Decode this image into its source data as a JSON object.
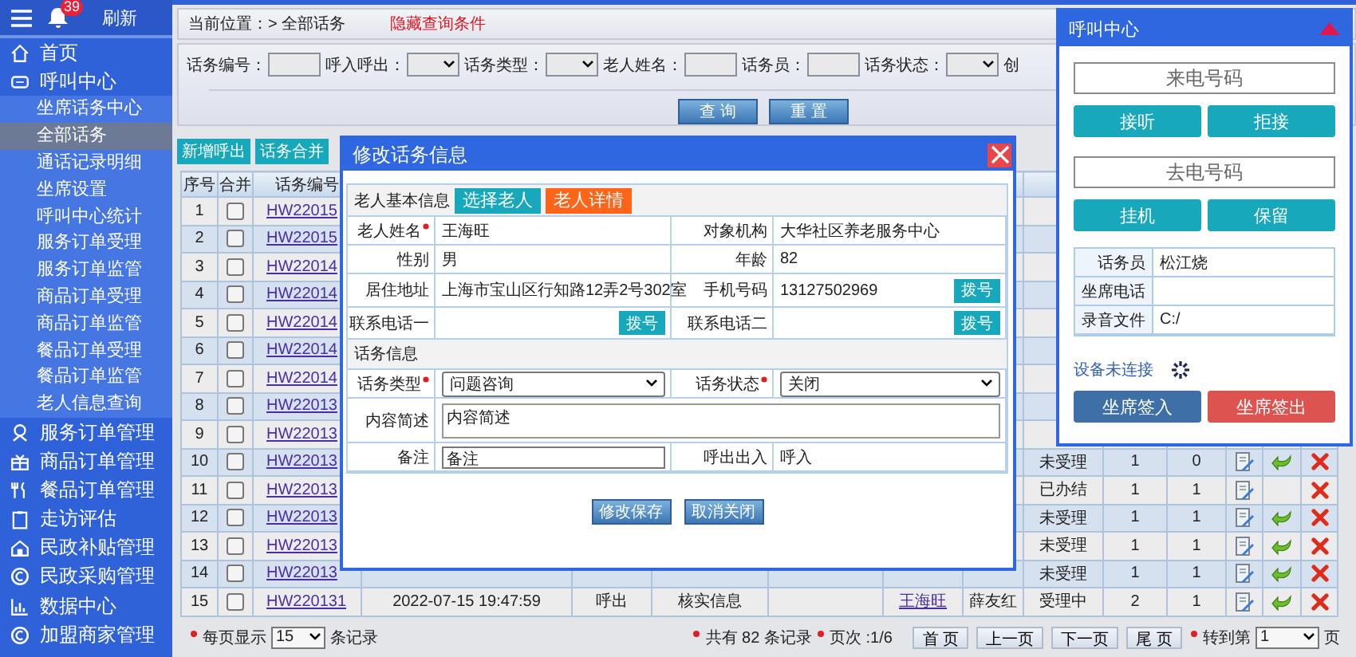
{
  "sidebar": {
    "badge": "39",
    "refresh": "刷新",
    "items": [
      {
        "label": "首页",
        "selected": false
      },
      {
        "label": "呼叫中心",
        "selected": false,
        "expanded": true,
        "children": [
          {
            "label": "坐席话务中心",
            "selected": false
          },
          {
            "label": "全部话务",
            "selected": true
          },
          {
            "label": "通话记录明细",
            "selected": false
          },
          {
            "label": "坐席设置",
            "selected": false
          },
          {
            "label": "呼叫中心统计",
            "selected": false
          },
          {
            "label": "服务订单受理",
            "selected": false
          },
          {
            "label": "服务订单监管",
            "selected": false
          },
          {
            "label": "商品订单受理",
            "selected": false
          },
          {
            "label": "商品订单监管",
            "selected": false
          },
          {
            "label": "餐品订单受理",
            "selected": false
          },
          {
            "label": "餐品订单监管",
            "selected": false
          },
          {
            "label": "老人信息查询",
            "selected": false
          }
        ]
      },
      {
        "label": "服务订单管理",
        "selected": false
      },
      {
        "label": "商品订单管理",
        "selected": false
      },
      {
        "label": "餐品订单管理",
        "selected": false
      },
      {
        "label": "走访评估",
        "selected": false
      },
      {
        "label": "民政补贴管理",
        "selected": false
      },
      {
        "label": "民政采购管理",
        "selected": false
      },
      {
        "label": "数据中心",
        "selected": false
      },
      {
        "label": "加盟商家管理",
        "selected": false
      }
    ]
  },
  "breadcrumb": "当前位置：> 全部话务",
  "hide_link": "隐藏查询条件",
  "search": {
    "fields": [
      {
        "label": "话务编号：",
        "kind": "input"
      },
      {
        "label": "呼入呼出：",
        "kind": "select"
      },
      {
        "label": "话务类型：",
        "kind": "select"
      },
      {
        "label": "老人姓名：",
        "kind": "input"
      },
      {
        "label": "话务员：",
        "kind": "input"
      },
      {
        "label": "话务状态：",
        "kind": "select"
      },
      {
        "label": "创",
        "kind": "label"
      }
    ],
    "buttons": [
      "查 询",
      "重 置"
    ]
  },
  "toolbar": [
    "新增呼出",
    "话务合并"
  ],
  "table": {
    "columns": [
      "序号",
      "合并",
      "话务编号"
    ],
    "rows": [
      {
        "no": "1",
        "checked": false,
        "code": "HW22015"
      },
      {
        "no": "2",
        "checked": false,
        "code": "HW22015"
      },
      {
        "no": "3",
        "checked": false,
        "code": "HW22014"
      },
      {
        "no": "4",
        "checked": false,
        "code": "HW22014"
      },
      {
        "no": "5",
        "checked": false,
        "code": "HW22014"
      },
      {
        "no": "6",
        "checked": false,
        "code": "HW22014"
      },
      {
        "no": "7",
        "checked": false,
        "code": "HW22014"
      },
      {
        "no": "8",
        "checked": false,
        "code": "HW22013"
      },
      {
        "no": "9",
        "checked": false,
        "code": "HW22013"
      },
      {
        "no": "10",
        "checked": false,
        "code": "HW22013",
        "column_10": "未受理",
        "column_11": "1",
        "column_12": "0",
        "returnable": true
      },
      {
        "no": "11",
        "checked": false,
        "code": "HW22013",
        "column_10": "已办结",
        "column_11": "1",
        "column_12": "1",
        "returnable": false
      },
      {
        "no": "12",
        "checked": false,
        "code": "HW22013",
        "column_10": "未受理",
        "column_11": "1",
        "column_12": "1",
        "returnable": true
      },
      {
        "no": "13",
        "checked": false,
        "code": "HW22013",
        "column_10": "未受理",
        "column_11": "1",
        "column_12": "1",
        "returnable": true
      },
      {
        "no": "14",
        "checked": false,
        "code": "HW22013",
        "column_10": "未受理",
        "column_11": "1",
        "column_12": "1",
        "returnable": true
      },
      {
        "no": "15",
        "checked": false,
        "code": "HW220131",
        "column_4": "2022-07-15 19:47:59",
        "column_5": "呼出",
        "column_6": "核实信息",
        "column_8": "王海旺",
        "column_9": "薛友红",
        "column_10": "受理中",
        "column_11": "2",
        "column_12": "1",
        "returnable": true
      }
    ]
  },
  "pagination": {
    "page_size_label": "每页显示",
    "page_size": "15",
    "records_label": "条记录",
    "total": "共有 82 条记录",
    "page_info": "页次 :1/6",
    "buttons": [
      "首 页",
      "上一页",
      "下一页",
      "尾 页"
    ],
    "goto_label": "转到第",
    "goto_value": "1",
    "goto_suffix": "页"
  },
  "dialog": {
    "title": "修改话务信息",
    "elder_header": "老人基本信息",
    "elder_buttons": [
      {
        "label": "选择老人",
        "kind": "select"
      },
      {
        "label": "老人详情",
        "kind": "detail"
      }
    ],
    "elder_fields": [
      {
        "label": "老人姓名",
        "required": true,
        "kind": "text",
        "value": "王海旺"
      },
      {
        "label": "对象机构",
        "required": false,
        "kind": "text",
        "value": "大华社区养老服务中心"
      },
      {
        "label": "性别",
        "required": false,
        "kind": "text",
        "value": "男"
      },
      {
        "label": "年龄",
        "required": false,
        "kind": "text",
        "value": "82"
      },
      {
        "label": "居住地址",
        "required": false,
        "kind": "text",
        "value": "上海市宝山区行知路12弄2号302室"
      },
      {
        "label": "手机号码",
        "required": false,
        "kind": "text",
        "value": "13127502969",
        "dial": "拨号"
      },
      {
        "label": "联系电话一",
        "required": false,
        "kind": "text",
        "dial": "拨号"
      },
      {
        "label": "联系电话二",
        "required": false,
        "kind": "text",
        "dial": "拨号"
      }
    ],
    "call_header": "话务信息",
    "call_fields": [
      {
        "label": "话务类型",
        "required": true,
        "kind": "select",
        "value": "问题咨询"
      },
      {
        "label": "话务状态",
        "required": true,
        "kind": "select",
        "value": "关闭"
      },
      {
        "label": "内容简述",
        "required": false,
        "kind": "textarea",
        "value": "内容简述"
      },
      {
        "label": "备注",
        "required": false,
        "kind": "input",
        "value": "备注"
      },
      {
        "label": "呼出出入",
        "required": false,
        "kind": "text",
        "value": "呼入"
      }
    ],
    "buttons": [
      "修改保存",
      "取消关闭"
    ]
  },
  "call_center": {
    "title": "呼叫中心",
    "incoming": {
      "placeholder": "来电号码"
    },
    "incoming_buttons": [
      "接听",
      "拒接"
    ],
    "outgoing": {
      "placeholder": "去电号码"
    },
    "outgoing_buttons": [
      "挂机",
      "保留"
    ],
    "info": [
      {
        "label": "话务员",
        "value": "松江烧"
      },
      {
        "label": "坐席电话"
      },
      {
        "label": "录音文件",
        "value": "C:/"
      }
    ],
    "device_status": "设备未连接",
    "sign_buttons": [
      {
        "label": "坐席签入",
        "kind": "sign_in"
      },
      {
        "label": "坐席签出",
        "kind": "sign_out"
      }
    ]
  }
}
